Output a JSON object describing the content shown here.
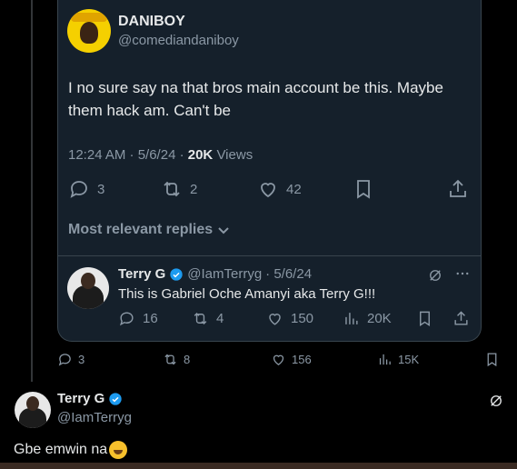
{
  "quoted_tweet": {
    "author_name": "DANIBOY",
    "author_handle": "@comediandaniboy",
    "text": "I no sure say na that bros main account be this. Maybe them hack am. Can't be",
    "time": "12:24 AM · 5/6/24 · ",
    "views_count": "20K",
    "views_label": " Views",
    "replies": "3",
    "reposts": "2",
    "likes": "42",
    "most_relevant_label": "Most relevant replies"
  },
  "reply": {
    "author_name": "Terry G",
    "author_handle": "@IamTerryg",
    "date": "· 5/6/24",
    "text": "This is Gabriel Oche Amanyi aka Terry G!!!",
    "replies": "16",
    "reposts": "4",
    "likes": "150",
    "views": "20K"
  },
  "outer_actions": {
    "replies": "3",
    "reposts": "8",
    "likes": "156",
    "views": "15K"
  },
  "bottom_tweet": {
    "author_name": "Terry G",
    "author_handle": "@IamTerryg",
    "text": "Gbe emwin na"
  },
  "colors": {
    "background": "#000000",
    "card": "#15202b",
    "muted": "#8b98a5",
    "verified": "#1d9bf0"
  }
}
